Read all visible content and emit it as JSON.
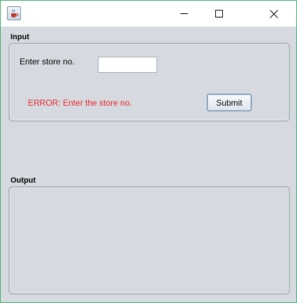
{
  "window": {
    "icon": "java-cup-icon",
    "controls": [
      "minimize-icon",
      "maximize-icon",
      "close-icon"
    ]
  },
  "input_section": {
    "title": "Input",
    "store_label": "Enter store no.",
    "store_value": "",
    "error_message": "ERROR: Enter the store no.",
    "submit_label": "Submit"
  },
  "output_section": {
    "title": "Output"
  },
  "colors": {
    "error": "#e8262b",
    "window_border": "#3bb36a",
    "background": "#d6d9df"
  }
}
